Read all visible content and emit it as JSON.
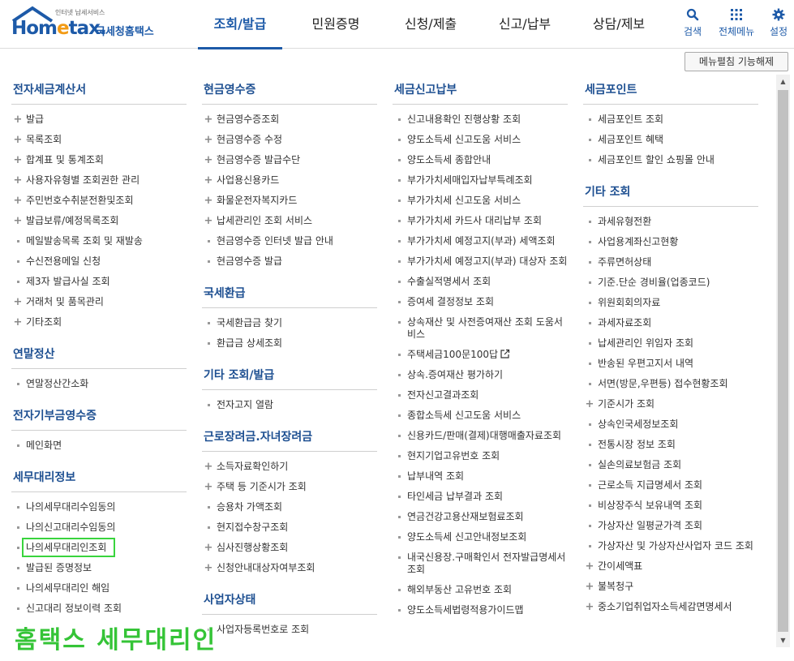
{
  "header": {
    "logo_top": "인터넷 납세서비스",
    "logo_main_a": "Hom",
    "logo_main_e": "e",
    "logo_main_b": "tax.",
    "logo_sub": "국세청홈택스",
    "gnb": [
      {
        "label": "조회/발급",
        "active": true
      },
      {
        "label": "민원증명",
        "active": false
      },
      {
        "label": "신청/제출",
        "active": false
      },
      {
        "label": "신고/납부",
        "active": false
      },
      {
        "label": "상담/제보",
        "active": false
      }
    ],
    "util": {
      "search": "검색",
      "allmenu": "전체메뉴",
      "settings": "설정"
    },
    "accent_color": "#1d5aa8"
  },
  "toggle_button": "메뉴펼침 기능해제",
  "columns": [
    {
      "sections": [
        {
          "title": "전자세금계산서",
          "items": [
            {
              "label": "발급",
              "marker": "plus"
            },
            {
              "label": "목록조회",
              "marker": "plus"
            },
            {
              "label": "합계표 및 통계조회",
              "marker": "plus"
            },
            {
              "label": "사용자유형별 조회권한 관리",
              "marker": "plus"
            },
            {
              "label": "주민번호수취분전환및조회",
              "marker": "plus"
            },
            {
              "label": "발급보류/예정목록조회",
              "marker": "plus"
            },
            {
              "label": "메일발송목록 조회 및 재발송",
              "marker": "bullet"
            },
            {
              "label": "수신전용메일 신청",
              "marker": "bullet"
            },
            {
              "label": "제3자 발급사실 조회",
              "marker": "bullet"
            },
            {
              "label": "거래처 및 품목관리",
              "marker": "plus"
            },
            {
              "label": "기타조회",
              "marker": "plus"
            }
          ]
        },
        {
          "title": "연말정산",
          "items": [
            {
              "label": "연말정산간소화",
              "marker": "bullet"
            }
          ]
        },
        {
          "title": "전자기부금영수증",
          "items": [
            {
              "label": "메인화면",
              "marker": "bullet"
            }
          ]
        },
        {
          "title": "세무대리정보",
          "items": [
            {
              "label": "나의세무대리수임동의",
              "marker": "bullet"
            },
            {
              "label": "나의신고대리수임동의",
              "marker": "bullet"
            },
            {
              "label": "나의세무대리인조회",
              "marker": "bullet",
              "highlight": true
            },
            {
              "label": "발급된 증명정보",
              "marker": "bullet"
            },
            {
              "label": "나의세무대리인 해임",
              "marker": "bullet"
            },
            {
              "label": "신고대리 정보이력 조회",
              "marker": "bullet"
            }
          ]
        }
      ]
    },
    {
      "sections": [
        {
          "title": "현금영수증",
          "items": [
            {
              "label": "현금영수증조회",
              "marker": "plus"
            },
            {
              "label": "현금영수증 수정",
              "marker": "plus"
            },
            {
              "label": "현금영수증 발급수단",
              "marker": "plus"
            },
            {
              "label": "사업용신용카드",
              "marker": "plus"
            },
            {
              "label": "화물운전자복지카드",
              "marker": "plus"
            },
            {
              "label": "납세관리인 조회 서비스",
              "marker": "plus"
            },
            {
              "label": "현금영수증 인터넷 발급 안내",
              "marker": "bullet"
            },
            {
              "label": "현금영수증 발급",
              "marker": "bullet"
            }
          ]
        },
        {
          "title": "국세환급",
          "items": [
            {
              "label": "국세환급금 찾기",
              "marker": "bullet"
            },
            {
              "label": "환급금 상세조회",
              "marker": "bullet"
            }
          ]
        },
        {
          "title": "기타 조회/발급",
          "items": [
            {
              "label": "전자고지 열람",
              "marker": "bullet"
            }
          ]
        },
        {
          "title": "근로장려금.자녀장려금",
          "items": [
            {
              "label": "소득자료확인하기",
              "marker": "plus"
            },
            {
              "label": "주택 등 기준시가 조회",
              "marker": "plus"
            },
            {
              "label": "승용차 가액조회",
              "marker": "bullet"
            },
            {
              "label": "현지접수창구조회",
              "marker": "bullet"
            },
            {
              "label": "심사진행상황조회",
              "marker": "plus"
            },
            {
              "label": "신청안내대상자여부조회",
              "marker": "plus"
            }
          ]
        },
        {
          "title": "사업자상태",
          "items": [
            {
              "label": "사업자등록번호로 조회",
              "marker": "bullet"
            }
          ]
        }
      ]
    },
    {
      "sections": [
        {
          "title": "세금신고납부",
          "items": [
            {
              "label": "신고내용확인 진행상황 조회",
              "marker": "bullet"
            },
            {
              "label": "양도소득세 신고도움 서비스",
              "marker": "bullet"
            },
            {
              "label": "양도소득세 종합안내",
              "marker": "bullet"
            },
            {
              "label": "부가가치세매입자납부특례조회",
              "marker": "bullet"
            },
            {
              "label": "부가가치세 신고도움 서비스",
              "marker": "bullet"
            },
            {
              "label": "부가가치세 카드사 대리납부 조회",
              "marker": "bullet"
            },
            {
              "label": "부가가치세 예정고지(부과) 세액조회",
              "marker": "bullet"
            },
            {
              "label": "부가가치세 예정고지(부과) 대상자 조회",
              "marker": "bullet"
            },
            {
              "label": "수출실적명세서 조회",
              "marker": "bullet"
            },
            {
              "label": "증여세 결정정보 조회",
              "marker": "bullet"
            },
            {
              "label": "상속재산 및 사전증여재산 조회 도움서비스",
              "marker": "bullet"
            },
            {
              "label": "주택세금100문100답",
              "marker": "bullet",
              "external": true
            },
            {
              "label": "상속.증여재산 평가하기",
              "marker": "bullet"
            },
            {
              "label": "전자신고결과조회",
              "marker": "bullet"
            },
            {
              "label": "종합소득세 신고도움 서비스",
              "marker": "bullet"
            },
            {
              "label": "신용카드/판매(결제)대행매출자료조회",
              "marker": "bullet"
            },
            {
              "label": "현지기업고유번호 조회",
              "marker": "bullet"
            },
            {
              "label": "납부내역 조회",
              "marker": "bullet"
            },
            {
              "label": "타인세금 납부결과 조회",
              "marker": "bullet"
            },
            {
              "label": "연금건강고용산재보험료조회",
              "marker": "bullet"
            },
            {
              "label": "양도소득세 신고안내정보조회",
              "marker": "bullet"
            },
            {
              "label": "내국신용장.구매확인서 전자발급명세서 조회",
              "marker": "bullet"
            },
            {
              "label": "해외부동산 고유번호 조회",
              "marker": "bullet"
            },
            {
              "label": "양도소득세법령적용가이드맵",
              "marker": "bullet"
            }
          ]
        }
      ]
    },
    {
      "sections": [
        {
          "title": "세금포인트",
          "items": [
            {
              "label": "세금포인트 조회",
              "marker": "bullet"
            },
            {
              "label": "세금포인트 혜택",
              "marker": "bullet"
            },
            {
              "label": "세금포인트 할인 쇼핑몰 안내",
              "marker": "bullet"
            }
          ]
        },
        {
          "title": "기타 조회",
          "items": [
            {
              "label": "과세유형전환",
              "marker": "bullet"
            },
            {
              "label": "사업용계좌신고현황",
              "marker": "bullet"
            },
            {
              "label": "주류면허상태",
              "marker": "bullet"
            },
            {
              "label": "기준.단순 경비율(업종코드)",
              "marker": "bullet"
            },
            {
              "label": "위원회회의자료",
              "marker": "bullet"
            },
            {
              "label": "과세자료조회",
              "marker": "bullet"
            },
            {
              "label": "납세관리인 위임자 조회",
              "marker": "bullet"
            },
            {
              "label": "반송된 우편고지서 내역",
              "marker": "bullet"
            },
            {
              "label": "서면(방문,우편등) 접수현황조회",
              "marker": "bullet"
            },
            {
              "label": "기준시가 조회",
              "marker": "plus"
            },
            {
              "label": "상속인국세정보조회",
              "marker": "bullet"
            },
            {
              "label": "전통시장 정보 조회",
              "marker": "bullet"
            },
            {
              "label": "실손의료보험금 조회",
              "marker": "bullet"
            },
            {
              "label": "근로소득 지급명세서 조회",
              "marker": "bullet"
            },
            {
              "label": "비상장주식 보유내역 조회",
              "marker": "bullet"
            },
            {
              "label": "가상자산 일평균가격 조회",
              "marker": "bullet"
            },
            {
              "label": "가상자산 및 가상자산사업자 코드 조회",
              "marker": "bullet"
            },
            {
              "label": "간이세액표",
              "marker": "plus"
            },
            {
              "label": "불복청구",
              "marker": "plus"
            },
            {
              "label": "중소기업취업자소득세감면명세서",
              "marker": "plus"
            }
          ]
        }
      ]
    }
  ],
  "watermark": "홈택스 세무대리인",
  "watermark_color": "#35c437"
}
